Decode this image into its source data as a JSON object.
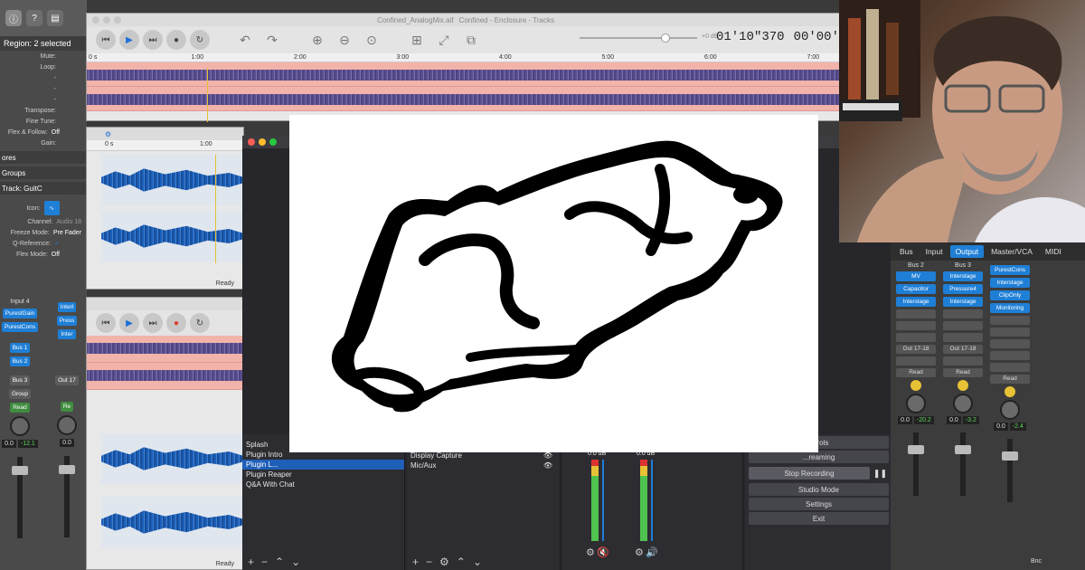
{
  "inspector": {
    "region_label": "Region: 2 selected",
    "rows": [
      {
        "label": "Mute:",
        "value": ""
      },
      {
        "label": "Loop:",
        "value": ""
      },
      {
        "label": "-",
        "value": ""
      },
      {
        "label": "-",
        "value": ""
      },
      {
        "label": "-",
        "value": ""
      },
      {
        "label": "Transpose:",
        "value": ""
      },
      {
        "label": "Fine Tune:",
        "value": ""
      },
      {
        "label": "Flex & Follow:",
        "value": "Off"
      },
      {
        "label": "Gain:",
        "value": ""
      }
    ],
    "section_more": "ores",
    "section_groups": "Groups",
    "track_label": "Track: GuitC",
    "icon_label": "Icon:",
    "channel_label": "Channel:",
    "channel_value": "Audio 18",
    "freeze_label": "Freeze Mode:",
    "freeze_value": "Pre Fader",
    "qref_label": "Q-Reference:",
    "flex_label": "Flex Mode:",
    "flex_value": "Off",
    "strips": [
      {
        "input": "Input 4",
        "plugins": [
          "PurestGain",
          "PurestCons"
        ],
        "sends": [
          "Bus 1",
          "Bus 2"
        ],
        "output": "Bus 3",
        "group": "Group",
        "mode": "Read",
        "values": [
          "0.0",
          "-12.1"
        ]
      },
      {
        "input": "",
        "plugins": [
          "Interl",
          "Press",
          "Inter"
        ],
        "sends": [],
        "output": "Out 17",
        "group": "",
        "mode": "Re",
        "values": [
          "0.0",
          ""
        ]
      }
    ]
  },
  "tracks_window": {
    "title": "Confined_AnalogMix.aif",
    "title_suffix": "Confined - Enclosure - Tracks",
    "volume_label": "+0 dB",
    "timecode": "01'10\"370",
    "timecode2": "00'00'",
    "ruler": [
      "0 s",
      "1:00",
      "2:00",
      "3:00",
      "4:00",
      "5:00",
      "6:00",
      "7:00"
    ]
  },
  "sub_window_1": {
    "ruler": [
      "0 s",
      "1:00"
    ],
    "status": "Ready"
  },
  "sub_window_2": {
    "status": "Ready"
  },
  "obs": {
    "scenes": [
      "Splash",
      "Plugin Intro",
      "Plugin L...",
      "Plugin Reaper",
      "Q&A With Chat"
    ],
    "selected_scene_index": 2,
    "sources": [
      "Display Capture",
      "Mic/Aux"
    ],
    "mixer_levels": [
      "0.0 dB",
      "0.0 dB"
    ],
    "controls": [
      "...trols",
      "...reaming",
      "Stop Recording",
      "Studio Mode",
      "Settings",
      "Exit"
    ]
  },
  "mixer": {
    "tabs": [
      "Bus",
      "Input",
      "Output",
      "Master/VCA",
      "MIDI"
    ],
    "selected_tab": "Output",
    "columns": [
      {
        "name": "Bus 2",
        "plugins": [
          "MV",
          "Capacitor",
          "Interstage"
        ],
        "output": "Out 17-18",
        "mode": "Read",
        "values": [
          "0.0",
          "-20.2"
        ]
      },
      {
        "name": "Bus 3",
        "plugins": [
          "Interstage",
          "Pressure4",
          "Interstage"
        ],
        "output": "Out 17-18",
        "mode": "Read",
        "values": [
          "0.0",
          "-3.2"
        ]
      },
      {
        "name": "",
        "plugins": [
          "PurestCons",
          "Interstage",
          "ClipOnly",
          "Monitoring"
        ],
        "output": "",
        "mode": "Read",
        "values": [
          "0.0",
          "-2.4"
        ]
      }
    ],
    "bottom_label": "Bnc"
  },
  "colors": {
    "accent": "#1f7fd6",
    "waveform_purple": "#5b4f8f",
    "waveform_blue": "#1c5fb8",
    "region_pink": "#f2b3aa"
  }
}
